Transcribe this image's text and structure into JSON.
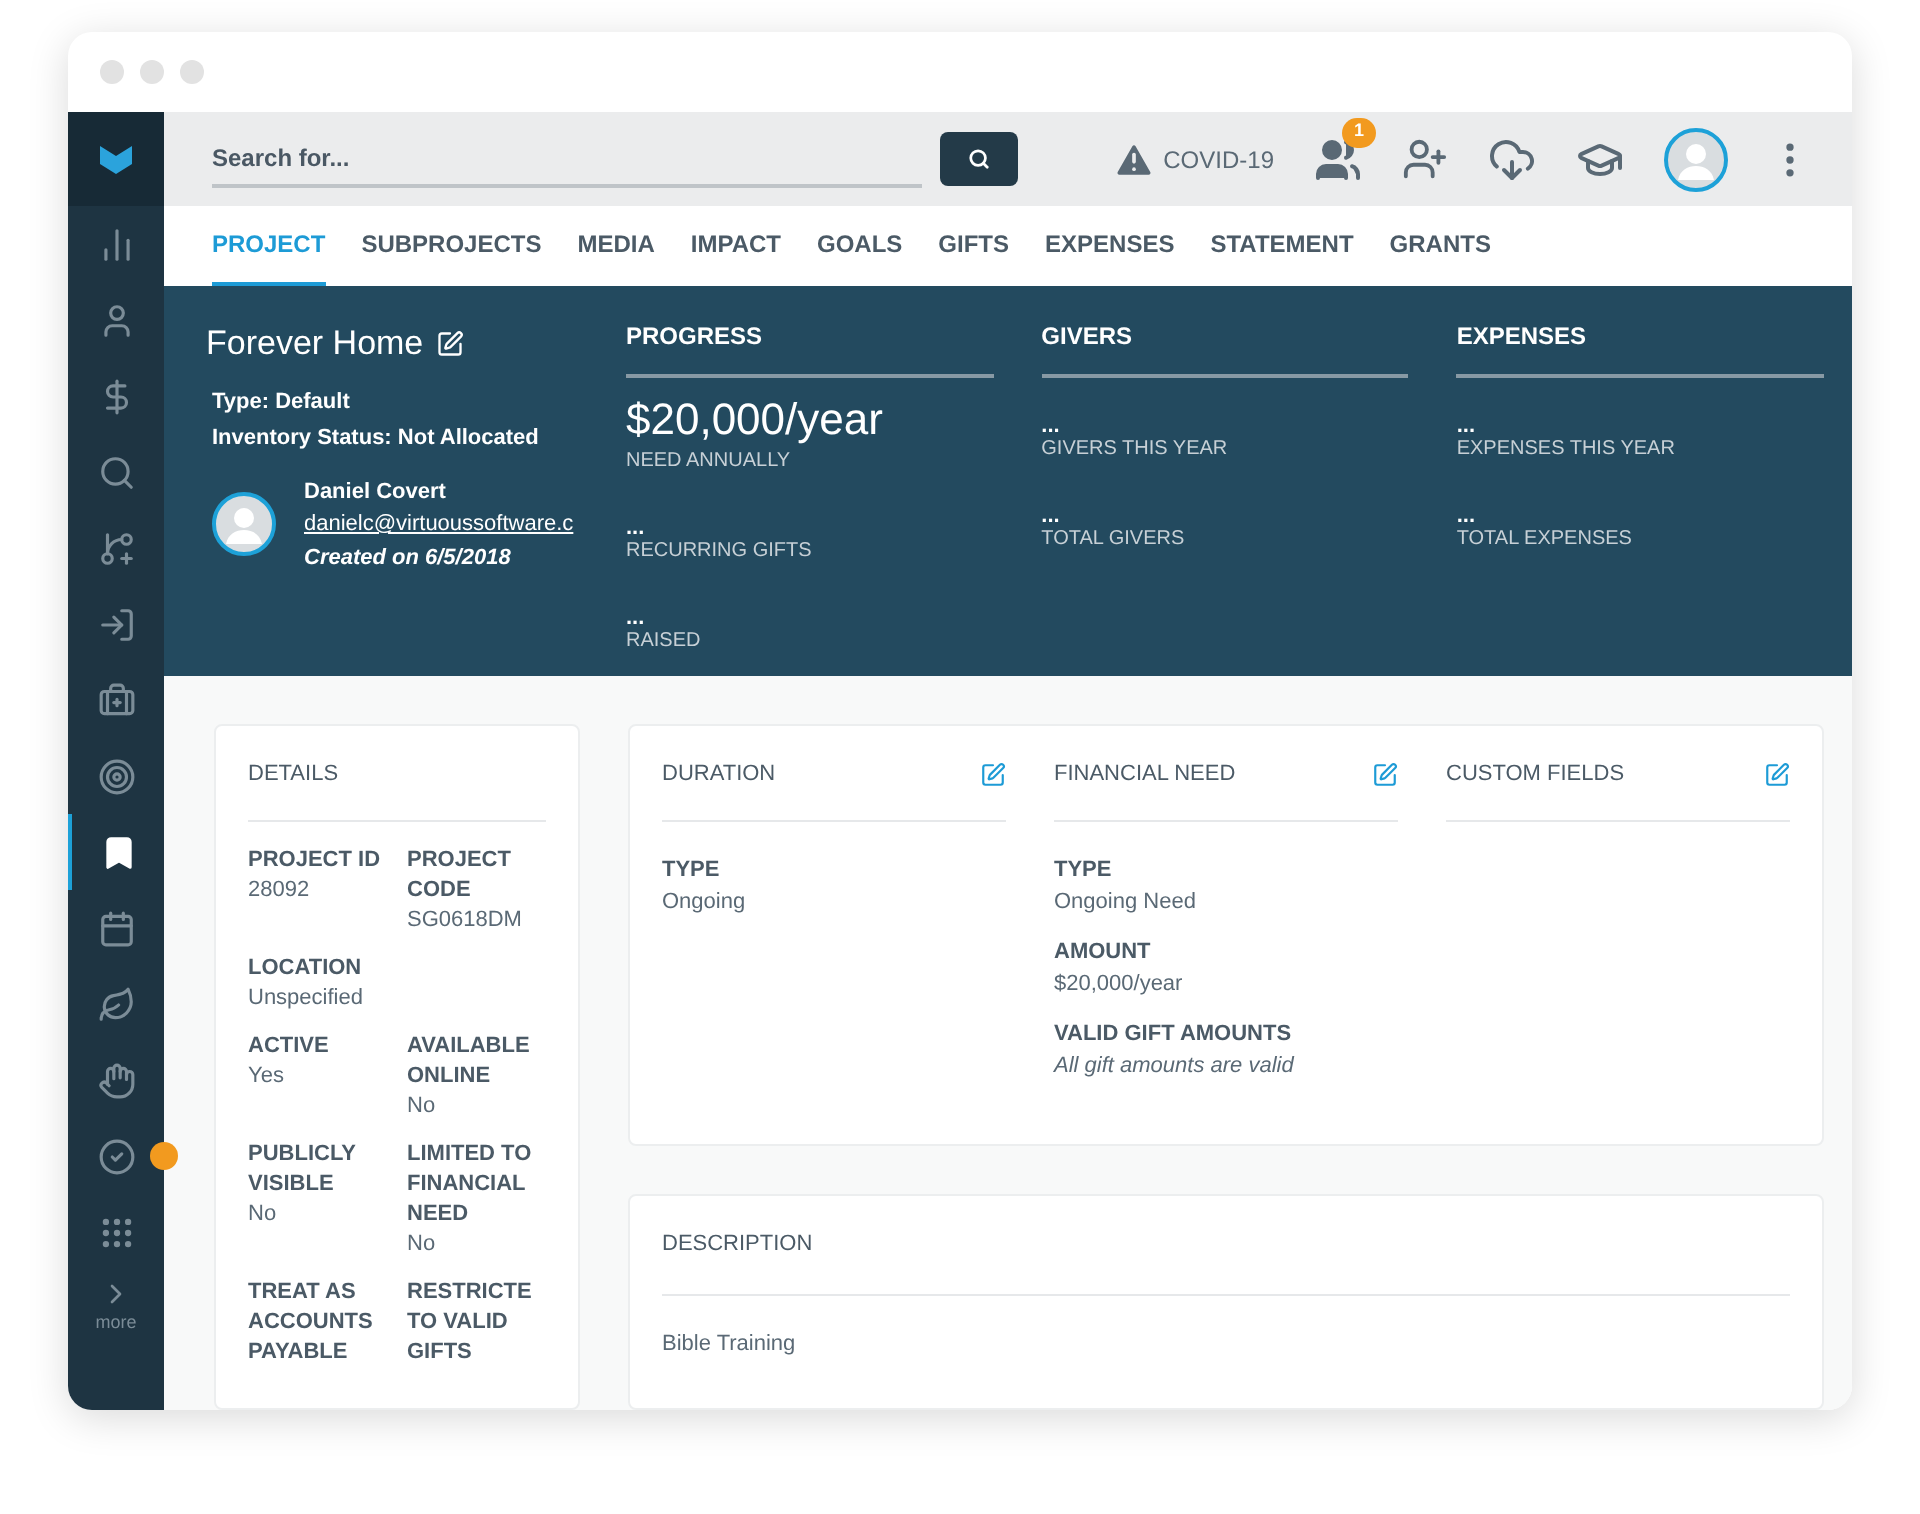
{
  "sidebar": {
    "items": [
      {
        "selected": false,
        "alert": false
      },
      {
        "selected": false,
        "alert": false
      },
      {
        "selected": false,
        "alert": false
      },
      {
        "selected": false,
        "alert": false
      },
      {
        "selected": false,
        "alert": false
      },
      {
        "selected": false,
        "alert": false
      },
      {
        "selected": false,
        "alert": false
      },
      {
        "selected": false,
        "alert": false
      },
      {
        "selected": true,
        "alert": false
      },
      {
        "selected": false,
        "alert": false
      },
      {
        "selected": false,
        "alert": false
      },
      {
        "selected": false,
        "alert": false
      },
      {
        "selected": false,
        "alert": true
      },
      {
        "selected": false,
        "alert": false
      }
    ],
    "more_label": "more"
  },
  "search": {
    "placeholder": "Search for..."
  },
  "topbar": {
    "covid_label": "COVID-19",
    "notification_count": "1"
  },
  "tabs": [
    {
      "label": "PROJECT",
      "selected": true
    },
    {
      "label": "SUBPROJECTS",
      "selected": false
    },
    {
      "label": "MEDIA",
      "selected": false
    },
    {
      "label": "IMPACT",
      "selected": false
    },
    {
      "label": "GOALS",
      "selected": false
    },
    {
      "label": "GIFTS",
      "selected": false
    },
    {
      "label": "EXPENSES",
      "selected": false
    },
    {
      "label": "STATEMENT",
      "selected": false
    },
    {
      "label": "GRANTS",
      "selected": false
    }
  ],
  "project": {
    "title": "Forever Home",
    "type": "Type: Default",
    "inventory": "Inventory Status: Not Allocated",
    "owner_name": "Daniel Covert",
    "owner_email": "danielc@virtuoussoftware.c",
    "created": "Created on 6/5/2018"
  },
  "summary": [
    {
      "title": "PROGRESS",
      "stats": [
        {
          "value": "$20,000/year",
          "label": "NEED ANNUALLY",
          "kind": "big"
        },
        {
          "value": "...",
          "label": "RECURRING GIFTS",
          "kind": "small"
        },
        {
          "value": "...",
          "label": "RAISED",
          "kind": "small"
        }
      ]
    },
    {
      "title": "GIVERS",
      "stats": [
        {
          "value": "...",
          "label": "GIVERS THIS YEAR",
          "kind": "small"
        },
        {
          "value": "...",
          "label": "TOTAL GIVERS",
          "kind": "small"
        }
      ]
    },
    {
      "title": "EXPENSES",
      "stats": [
        {
          "value": "...",
          "label": "EXPENSES THIS YEAR",
          "kind": "small"
        },
        {
          "value": "...",
          "label": "TOTAL EXPENSES",
          "kind": "small"
        }
      ]
    }
  ],
  "details": {
    "title": "DETAILS",
    "fields": [
      {
        "label": "PROJECT ID",
        "value": "28092",
        "wide": false
      },
      {
        "label": "PROJECT CODE",
        "value": "SG0618DM",
        "wide": false
      },
      {
        "label": "LOCATION",
        "value": "Unspecified",
        "wide": true
      },
      {
        "label": "ACTIVE",
        "value": "Yes",
        "wide": false
      },
      {
        "label": "AVAILABLE ONLINE",
        "value": "No",
        "wide": false
      },
      {
        "label": "PUBLICLY VISIBLE",
        "value": "No",
        "wide": false
      },
      {
        "label": "LIMITED TO FINANCIAL NEED",
        "value": "No",
        "wide": false
      },
      {
        "label": "TREAT AS ACCOUNTS PAYABLE",
        "wide": false
      },
      {
        "label": "RESTRICTE TO VALID GIFTS",
        "wide": false
      }
    ]
  },
  "sections": [
    {
      "title": "DURATION",
      "fields": [
        {
          "label": "TYPE",
          "value": "Ongoing",
          "italic": false
        }
      ]
    },
    {
      "title": "FINANCIAL NEED",
      "fields": [
        {
          "label": "TYPE",
          "value": "Ongoing Need",
          "italic": false
        },
        {
          "label": "AMOUNT",
          "value": "$20,000/year",
          "italic": false
        },
        {
          "label": "VALID GIFT AMOUNTS",
          "value": "All gift amounts are valid",
          "italic": true
        }
      ]
    },
    {
      "title": "CUSTOM FIELDS"
    }
  ],
  "description": {
    "title": "DESCRIPTION",
    "text": "Bible Training"
  }
}
